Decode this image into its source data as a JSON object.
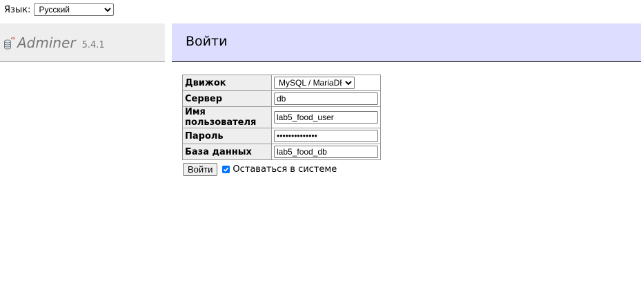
{
  "language": {
    "label": "Язык:",
    "selected": "Русский"
  },
  "logo": {
    "name": "Adminer",
    "version": "5.4.1",
    "icon": "database-icon"
  },
  "page": {
    "title": "Войти"
  },
  "login_form": {
    "fields": [
      {
        "label": "Движок",
        "type": "select",
        "value": "MySQL / MariaDB"
      },
      {
        "label": "Сервер",
        "type": "text",
        "value": "db"
      },
      {
        "label": "Имя пользователя",
        "type": "text",
        "value": "lab5_food_user"
      },
      {
        "label": "Пароль",
        "type": "password",
        "value": "••••••••••••••"
      },
      {
        "label": "База данных",
        "type": "text",
        "value": "lab5_food_db"
      }
    ],
    "submit_label": "Войти",
    "remember_label": "Оставаться в системе",
    "remember_checked": true
  },
  "colors": {
    "content_header_bg": "#ddddff",
    "menu_header_bg": "#eeeeee",
    "checkbox_accent": "#0075ff"
  }
}
